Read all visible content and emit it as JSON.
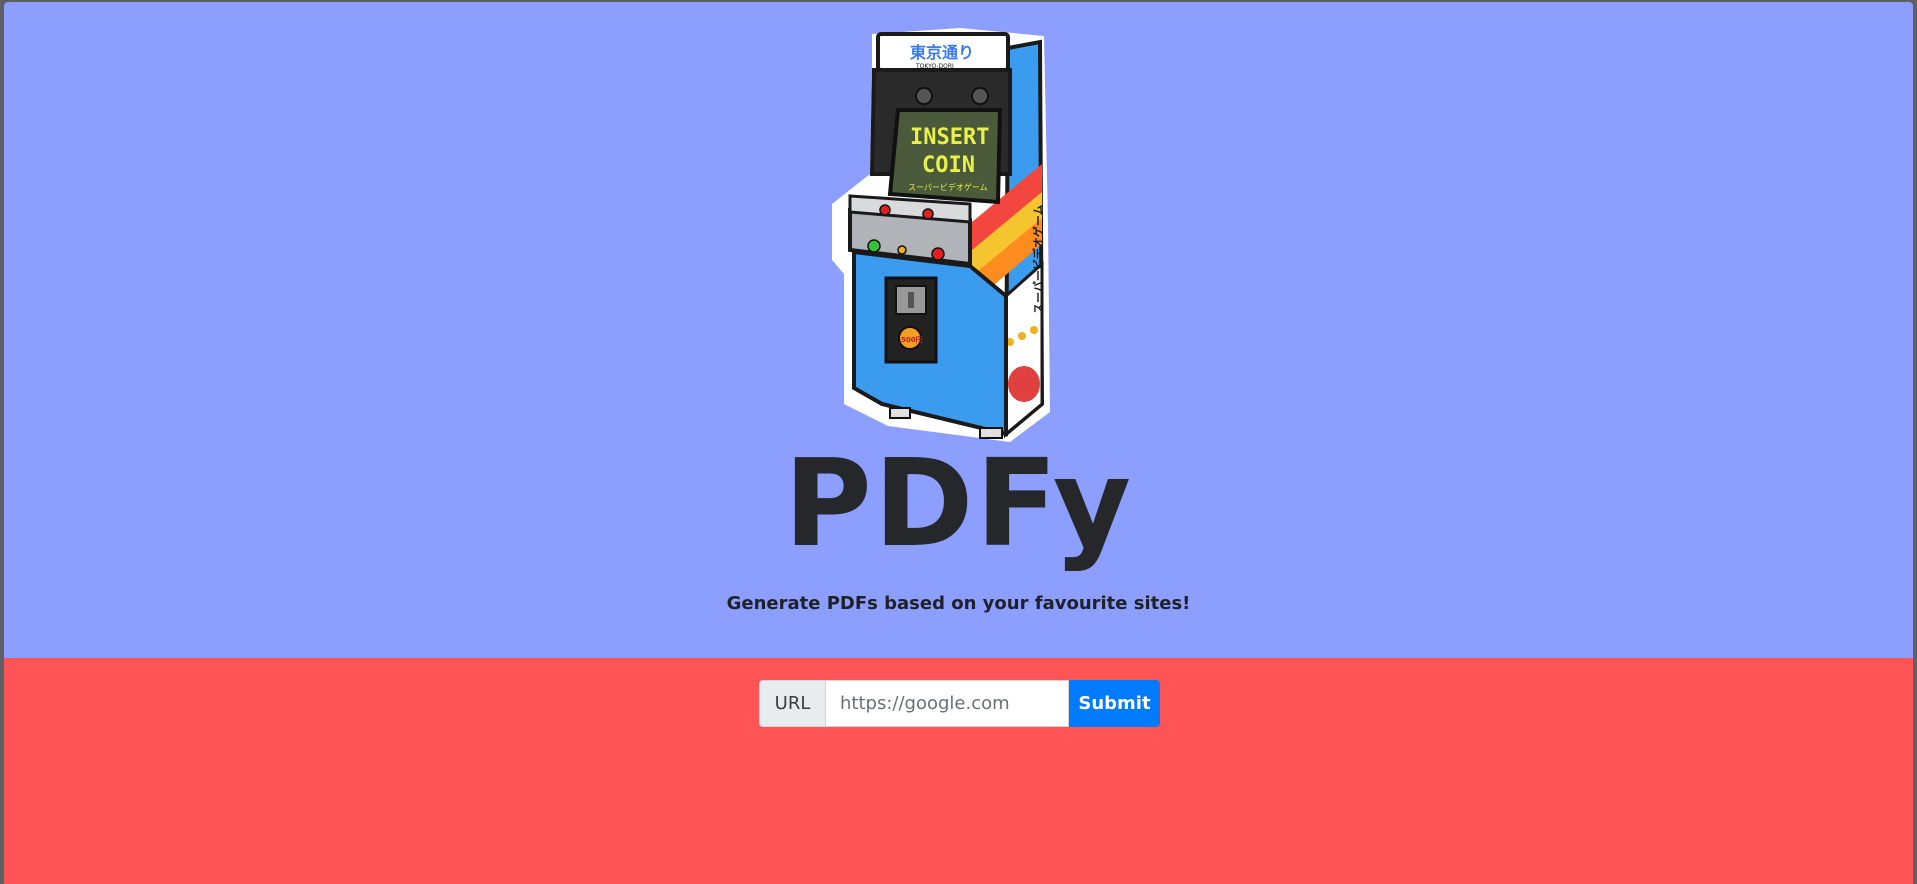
{
  "header": {
    "title": "PDFy",
    "subtitle": "Generate PDFs based on your favourite sites!"
  },
  "illustration": {
    "marquee_text": "東京通り",
    "marquee_sub": "TOKYO-DORI",
    "screen_line1": "INSERT",
    "screen_line2": "COIN",
    "screen_sub": "スーパービデオゲーム",
    "side_text": "スーパービデオゲーム",
    "coin_label": "500円"
  },
  "form": {
    "url_label": "URL",
    "url_placeholder": "https://google.com",
    "submit_label": "Submit"
  },
  "colors": {
    "hero_bg": "#8c9efe",
    "bottom_bg": "#ff5455",
    "accent": "#007bff"
  }
}
